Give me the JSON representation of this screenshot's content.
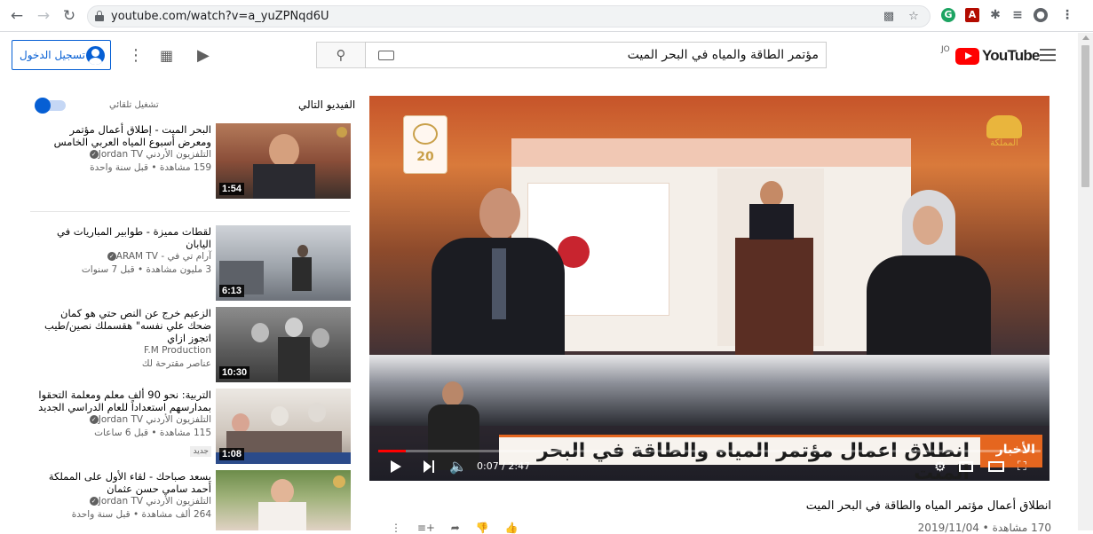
{
  "browser": {
    "url": "youtube.com/watch?v=a_yuZPNqd6U"
  },
  "masthead": {
    "sign_in_label": "تسجيل الدخول",
    "search_value": "مؤتمر الطاقة والمياه في البحر الميت",
    "logo_text": "YouTube",
    "country_code": "JO"
  },
  "sidebar": {
    "up_next_label": "الفيديو التالي",
    "autoplay_label": "تشغيل تلقائي",
    "autoplay_on": true,
    "items": [
      {
        "title": "البحر الميت - إطلاق أعمال مؤتمر ومعرض أسبوع المياه العربي الخامس",
        "channel": "التلفزيون الأردني Jordan TV",
        "stats": "159 مشاهدة • قبل سنة واحدة",
        "duration": "1:54"
      },
      {
        "title": "لقطات مميزة - طوابير المباريات في اليابان",
        "channel": "آرام تي في - ARAM TV",
        "stats": "3 مليون مشاهدة • قبل 7 سنوات",
        "duration": "6:13"
      },
      {
        "title": "الزعيم خرج عن النص حتي هو كمان ضحك علي نفسه\" هقسملك نصين/طيب اتجوز ازاي",
        "channel": "F.M Production",
        "stats": "عناصر مقترحة لك",
        "duration": "10:30"
      },
      {
        "title": "التربية: نحو 90 ألف معلم ومعلمة التحقوا بمدارسهم استعداداً للعام الدراسي الجديد",
        "channel": "التلفزيون الأردني Jordan TV",
        "stats": "115 مشاهدة • قبل 6 ساعات",
        "badge": "جديد",
        "duration": "1:08"
      },
      {
        "title": "يسعد صباحك - لقاء الأول على المملكة أحمد سامي حسن عثمان",
        "channel": "التلفزيون الأردني Jordan TV",
        "stats": "264 ألف مشاهدة • قبل سنة واحدة",
        "duration": ""
      }
    ]
  },
  "player": {
    "time_current": "0:07",
    "time_total": "2:47",
    "time_separator": " / ",
    "progress_fraction": 0.042,
    "ticker_text": "انطلاق اعمال مؤتمر المياه والطاقة في البحر الميت",
    "ticker_tag": "الأخبار",
    "logo_right_text": "المملكة",
    "logo_left_text": "20"
  },
  "video": {
    "title": "انطلاق أعمال مؤتمر المياه والطاقة في البحر الميت",
    "views": "170 مشاهدة",
    "date": "2019/11/04"
  },
  "colors": {
    "accent": "#065fd4",
    "youtube_red": "#ff0000",
    "ticker_orange": "#e5661f"
  }
}
